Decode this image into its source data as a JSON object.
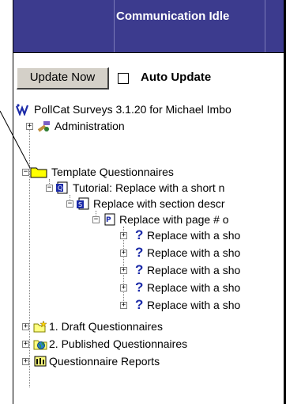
{
  "header": {
    "title": "Communication Idle"
  },
  "toolbar": {
    "update_label": "Update Now",
    "auto_update_label": "Auto Update",
    "auto_update_checked": false
  },
  "tree": {
    "root": "PollCat Surveys 3.1.20 for Michael Imbo",
    "administration": "Administration",
    "template_questionnaires": "Template Questionnaires",
    "tutorial": "Tutorial: Replace with a short n",
    "section": "Replace with section descr",
    "page": "Replace with page # o",
    "questions": [
      "Replace with a sho",
      "Replace with a sho",
      "Replace with a sho",
      "Replace with a sho",
      "Replace with a sho"
    ],
    "draft": "1. Draft Questionnaires",
    "published": "2. Published Questionnaires",
    "reports": "Questionnaire Reports"
  }
}
